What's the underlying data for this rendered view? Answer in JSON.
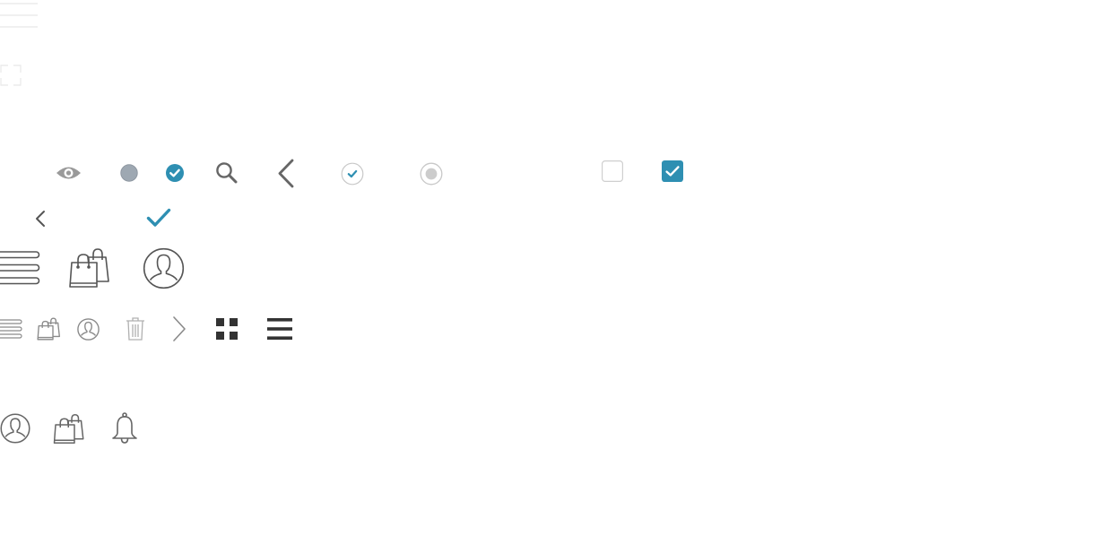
{
  "colors": {
    "accent": "#2e8fb2",
    "icon_dark": "#444444",
    "icon_mid": "#666666",
    "icon_light": "#9a9a9a",
    "icon_faint": "#e6e6e6",
    "disabled": "#cccccc",
    "checkbox_border": "#cfcfcf"
  },
  "sprite": {
    "row_top_faint": [
      "menu-icon",
      "expand-icon"
    ],
    "row_1": [
      "eye-icon",
      "dot-grey-icon",
      "check-circle-filled-icon",
      "search-icon",
      "chevron-left-large-icon",
      "check-circle-outline-icon",
      "radio-disabled-icon",
      "checkbox-unchecked-icon",
      "checkbox-checked-icon"
    ],
    "row_2": [
      "chevron-left-small-icon",
      "checkmark-icon"
    ],
    "row_3_large": [
      "menu-icon",
      "shopping-bags-icon",
      "user-icon"
    ],
    "row_4_small": [
      "menu-icon",
      "shopping-bags-icon",
      "user-icon",
      "trash-icon",
      "chevron-right-icon",
      "grid-view-icon",
      "list-view-icon"
    ],
    "row_5_medium": [
      "user-icon",
      "shopping-bags-icon",
      "bell-icon"
    ]
  }
}
